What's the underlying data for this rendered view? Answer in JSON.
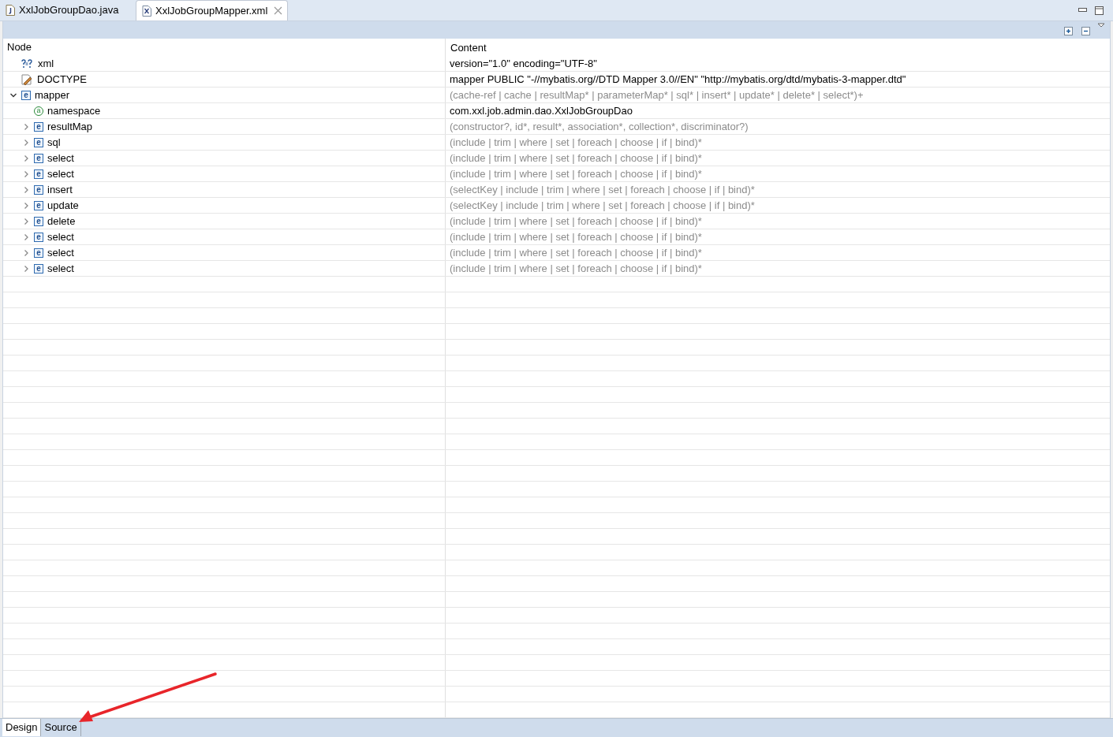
{
  "editor_tabs": [
    {
      "label": "XxlJobGroupDao.java",
      "kind": "java",
      "selected": false
    },
    {
      "label": "XxlJobGroupMapper.xml",
      "kind": "xml",
      "selected": true
    }
  ],
  "table": {
    "columns": [
      "Node",
      "Content"
    ],
    "nodes": [
      {
        "name": "xml",
        "kind": "pi",
        "content": "version=\"1.0\" encoding=\"UTF-8\"",
        "hint": false
      },
      {
        "name": "DOCTYPE",
        "kind": "doctype",
        "content": "mapper PUBLIC \"-//mybatis.org//DTD Mapper 3.0//EN\" \"http://mybatis.org/dtd/mybatis-3-mapper.dtd\"",
        "hint": false
      },
      {
        "name": "mapper",
        "kind": "element",
        "icon": "e",
        "expanded": true,
        "content": "(cache-ref | cache | resultMap* | parameterMap* | sql* | insert* | update* | delete* | select*)+",
        "hint": true,
        "children": [
          {
            "name": "namespace",
            "kind": "attribute",
            "icon": "a",
            "content": "com.xxl.job.admin.dao.XxlJobGroupDao",
            "hint": false
          },
          {
            "name": "resultMap",
            "kind": "element",
            "icon": "e",
            "expanded": false,
            "content": "(constructor?, id*, result*, association*, collection*, discriminator?)",
            "hint": true
          },
          {
            "name": "sql",
            "kind": "element",
            "icon": "e",
            "expanded": false,
            "content": "(include | trim | where | set | foreach | choose | if | bind)*",
            "hint": true
          },
          {
            "name": "select",
            "kind": "element",
            "icon": "e",
            "expanded": false,
            "content": "(include | trim | where | set | foreach | choose | if | bind)*",
            "hint": true
          },
          {
            "name": "select",
            "kind": "element",
            "icon": "e",
            "expanded": false,
            "content": "(include | trim | where | set | foreach | choose | if | bind)*",
            "hint": true
          },
          {
            "name": "insert",
            "kind": "element",
            "icon": "e",
            "expanded": false,
            "content": "(selectKey | include | trim | where | set | foreach | choose | if | bind)*",
            "hint": true
          },
          {
            "name": "update",
            "kind": "element",
            "icon": "e",
            "expanded": false,
            "content": "(selectKey | include | trim | where | set | foreach | choose | if | bind)*",
            "hint": true
          },
          {
            "name": "delete",
            "kind": "element",
            "icon": "e",
            "expanded": false,
            "content": "(include | trim | where | set | foreach | choose | if | bind)*",
            "hint": true
          },
          {
            "name": "select",
            "kind": "element",
            "icon": "e",
            "expanded": false,
            "content": "(include | trim | where | set | foreach | choose | if | bind)*",
            "hint": true
          },
          {
            "name": "select",
            "kind": "element",
            "icon": "e",
            "expanded": false,
            "content": "(include | trim | where | set | foreach | choose | if | bind)*",
            "hint": true
          },
          {
            "name": "select",
            "kind": "element",
            "icon": "e",
            "expanded": false,
            "content": "(include | trim | where | set | foreach | choose | if | bind)*",
            "hint": true
          }
        ]
      }
    ]
  },
  "page_tabs": [
    {
      "label": "Design",
      "selected": true
    },
    {
      "label": "Source",
      "selected": false
    }
  ]
}
